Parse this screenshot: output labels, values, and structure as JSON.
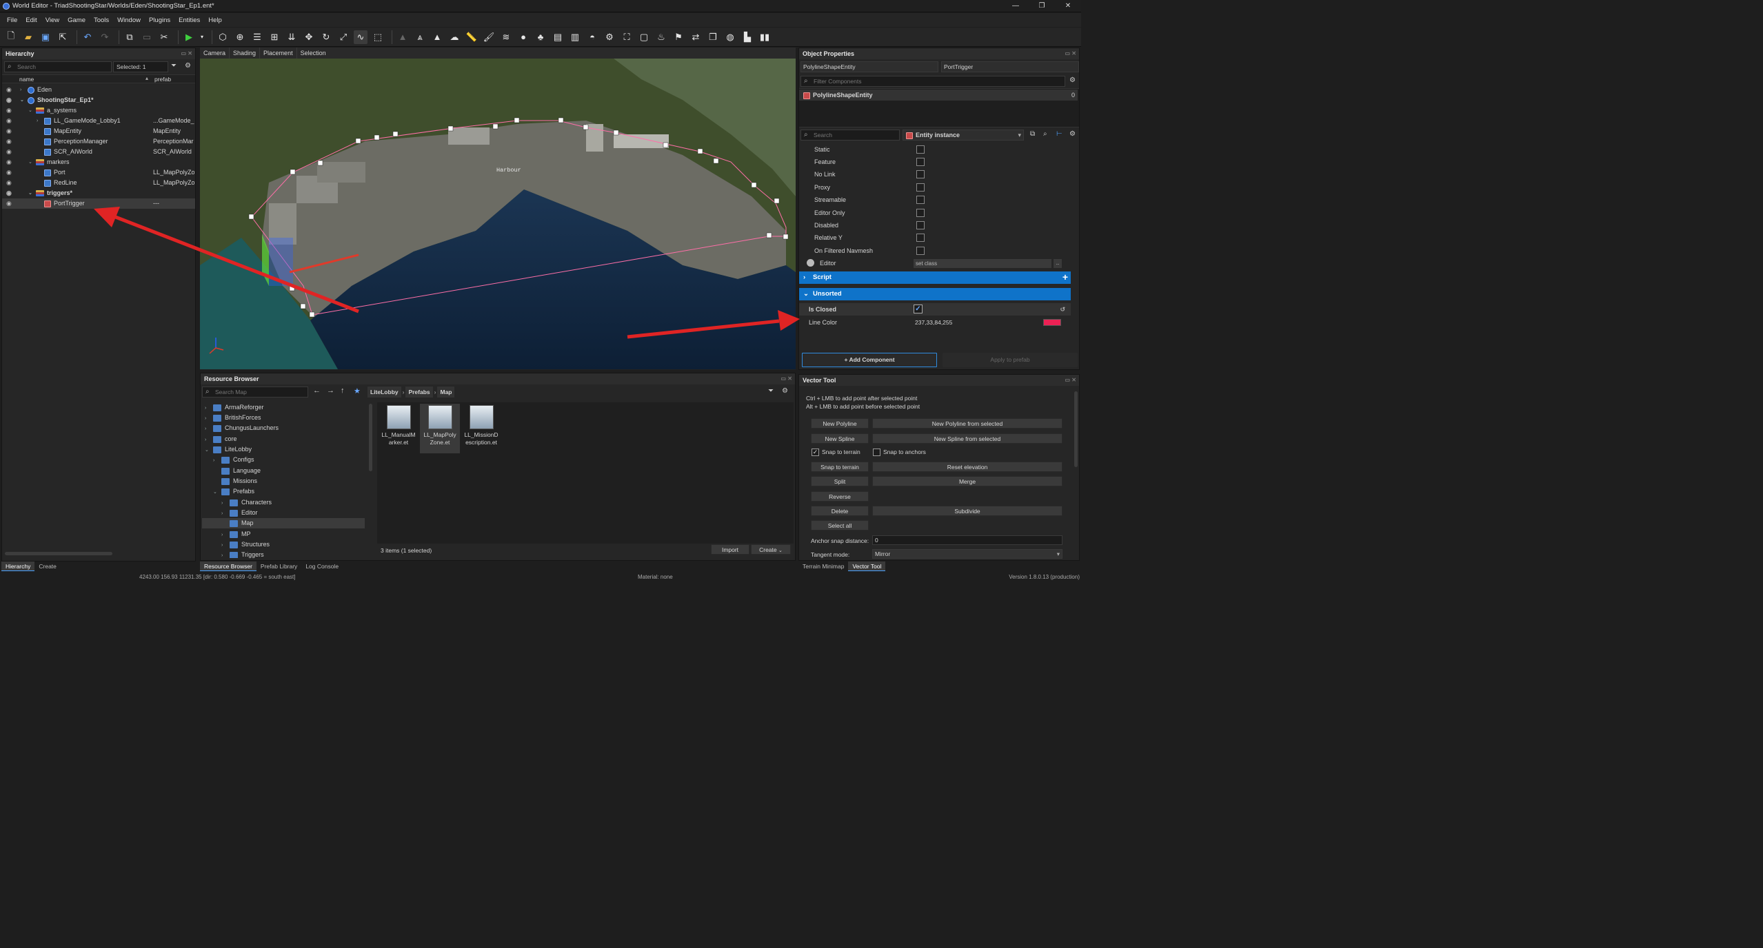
{
  "window": {
    "title": "World Editor - TriadShootingStar/Worlds/Eden/ShootingStar_Ep1.ent*",
    "min": "—",
    "max": "❐",
    "close": "✕"
  },
  "menu": [
    "File",
    "Edit",
    "View",
    "Game",
    "Tools",
    "Window",
    "Plugins",
    "Entities",
    "Help"
  ],
  "hierarchy": {
    "title": "Hierarchy",
    "search_placeholder": "Search",
    "selected": "Selected: 1",
    "col_name": "name",
    "col_prefab": "prefab",
    "rows": [
      {
        "label": "Eden",
        "prefab": "",
        "bold": false
      },
      {
        "label": "ShootingStar_Ep1*",
        "prefab": "",
        "bold": true
      },
      {
        "label": "a_systems",
        "prefab": "",
        "bold": false
      },
      {
        "label": "LL_GameMode_Lobby1",
        "prefab": "...GameMode_L",
        "bold": false
      },
      {
        "label": "MapEntity",
        "prefab": "MapEntity",
        "bold": false
      },
      {
        "label": "PerceptionManager",
        "prefab": "PerceptionMar",
        "bold": false
      },
      {
        "label": "SCR_AIWorld",
        "prefab": "SCR_AIWorld",
        "bold": false
      },
      {
        "label": "markers",
        "prefab": "",
        "bold": false
      },
      {
        "label": "Port",
        "prefab": "LL_MapPolyZo",
        "bold": false
      },
      {
        "label": "RedLine",
        "prefab": "LL_MapPolyZo",
        "bold": false
      },
      {
        "label": "triggers*",
        "prefab": "",
        "bold": true
      },
      {
        "label": "PortTrigger",
        "prefab": "---",
        "bold": false
      }
    ],
    "tabs": [
      "Hierarchy",
      "Create"
    ]
  },
  "viewport": {
    "tabs": [
      "Camera",
      "Shading",
      "Placement",
      "Selection"
    ],
    "map_label": "Harbour"
  },
  "object_properties": {
    "title": "Object Properties",
    "entity_class": "PolylineShapeEntity",
    "entity_name": "PortTrigger",
    "filter_placeholder": "Filter Components",
    "component": "PolylineShapeEntity",
    "component_count": "0",
    "search_placeholder": "Search",
    "instance_label": "Entity instance",
    "flags": [
      "Static",
      "Feature",
      "No Link",
      "Proxy",
      "Streamable",
      "Editor Only",
      "Disabled",
      "Relative Y",
      "On Filtered Navmesh"
    ],
    "editor_label": "Editor",
    "editor_value": "set class",
    "editor_btn": "..",
    "script_section": "Script",
    "unsorted_section": "Unsorted",
    "is_closed_label": "Is Closed",
    "is_closed": true,
    "line_color_label": "Line Color",
    "line_color_value": "237,33,84,255",
    "line_color_hex": "#ed2154",
    "add_component": "+ Add Component",
    "apply_prefab": "Apply to prefab"
  },
  "resource_browser": {
    "title": "Resource Browser",
    "search_placeholder": "Search Map",
    "breadcrumb": [
      "LiteLobby",
      "Prefabs",
      "Map"
    ],
    "tree": [
      {
        "label": "ArmaReforger",
        "indent": 0,
        "caret": "›"
      },
      {
        "label": "BritishForces",
        "indent": 0,
        "caret": "›"
      },
      {
        "label": "ChungusLaunchers",
        "indent": 0,
        "caret": "›"
      },
      {
        "label": "core",
        "indent": 0,
        "caret": "›"
      },
      {
        "label": "LiteLobby",
        "indent": 0,
        "caret": "⌄"
      },
      {
        "label": "Configs",
        "indent": 1,
        "caret": "›"
      },
      {
        "label": "Language",
        "indent": 1,
        "caret": ""
      },
      {
        "label": "Missions",
        "indent": 1,
        "caret": ""
      },
      {
        "label": "Prefabs",
        "indent": 1,
        "caret": "⌄"
      },
      {
        "label": "Characters",
        "indent": 2,
        "caret": "›"
      },
      {
        "label": "Editor",
        "indent": 2,
        "caret": "›"
      },
      {
        "label": "Map",
        "indent": 2,
        "caret": ""
      },
      {
        "label": "MP",
        "indent": 2,
        "caret": "›"
      },
      {
        "label": "Structures",
        "indent": 2,
        "caret": "›"
      },
      {
        "label": "Triggers",
        "indent": 2,
        "caret": "›"
      }
    ],
    "files": [
      {
        "line1": "LL_ManualM",
        "line2": "arker.et"
      },
      {
        "line1": "LL_MapPoly",
        "line2": "Zone.et"
      },
      {
        "line1": "LL_MissionD",
        "line2": "escription.et"
      }
    ],
    "status": "3 items (1 selected)",
    "import": "Import",
    "create": "Create",
    "tabs": [
      "Resource Browser",
      "Prefab Library",
      "Log Console"
    ]
  },
  "vector_tool": {
    "title": "Vector Tool",
    "hint1": "Ctrl + LMB to add point after selected point",
    "hint2": "Alt + LMB to add point before selected point",
    "new_polyline": "New Polyline",
    "new_polyline_sel": "New Polyline from selected",
    "new_spline": "New Spline",
    "new_spline_sel": "New Spline from selected",
    "snap_terrain_chk": "Snap to terrain",
    "snap_anchors_chk": "Snap to anchors",
    "snap_terrain_btn": "Snap to terrain",
    "reset_elevation": "Reset elevation",
    "split": "Split",
    "merge": "Merge",
    "reverse": "Reverse",
    "delete": "Delete",
    "subdivide": "Subdivide",
    "select_all": "Select all",
    "anchor_label": "Anchor snap distance:",
    "anchor_value": "0",
    "tangent_label": "Tangent mode:",
    "tangent_value": "Mirror",
    "tabs": [
      "Terrain Minimap",
      "Vector Tool"
    ]
  },
  "statusbar": {
    "coords": "4243.00    156.93   11231.35 [dir: 0.580 -0.669 -0.465 = south east]",
    "material": "Material: none",
    "version": "Version 1.8.0.13 (production)"
  },
  "colors": {
    "accent": "#0f73c9",
    "arrow": "#e02424"
  }
}
